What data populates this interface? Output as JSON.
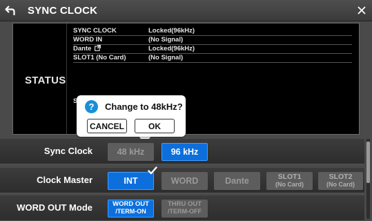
{
  "window": {
    "title": "SYNC CLOCK"
  },
  "status": {
    "label": "STATUS",
    "rows": [
      {
        "key": "SYNC CLOCK",
        "value": "Locked(96kHz)"
      },
      {
        "key": "WORD IN",
        "value": "(No Signal)"
      },
      {
        "key": "Dante",
        "value": "Locked(96kHz)"
      },
      {
        "key": "SLOT1 (No Card)",
        "value": "(No Signal)"
      }
    ],
    "fragment": "S"
  },
  "dialog": {
    "message": "Change to 48kHz?",
    "cancel_label": "CANCEL",
    "ok_label": "OK"
  },
  "settings": {
    "sync_clock": {
      "label": "Sync Clock",
      "options": [
        "48 kHz",
        "96 kHz"
      ],
      "selected": "96 kHz"
    },
    "clock_master": {
      "label": "Clock Master",
      "int_label": "INT",
      "word_label": "WORD",
      "dante_label": "Dante",
      "slot1_label": "SLOT1",
      "slot1_sub": "(No Card)",
      "slot2_label": "SLOT2",
      "slot2_sub": "(No Card)",
      "selected": "INT"
    },
    "word_out_mode": {
      "label": "WORD OUT Mode",
      "opt1_line1": "WORD OUT",
      "opt1_line2": "/TERM-ON",
      "opt2_line1": "THRU OUT",
      "opt2_line2": "/TERM-OFF",
      "selected": "WORD OUT /TERM-ON"
    }
  },
  "colors": {
    "accent": "#0c6fdc",
    "help_icon": "#1a8fd8"
  },
  "icons": {
    "back": "back-arrow-icon",
    "close": "close-icon",
    "dante_link": "external-link-icon",
    "help": "question-icon",
    "selected_check": "check-icon"
  }
}
